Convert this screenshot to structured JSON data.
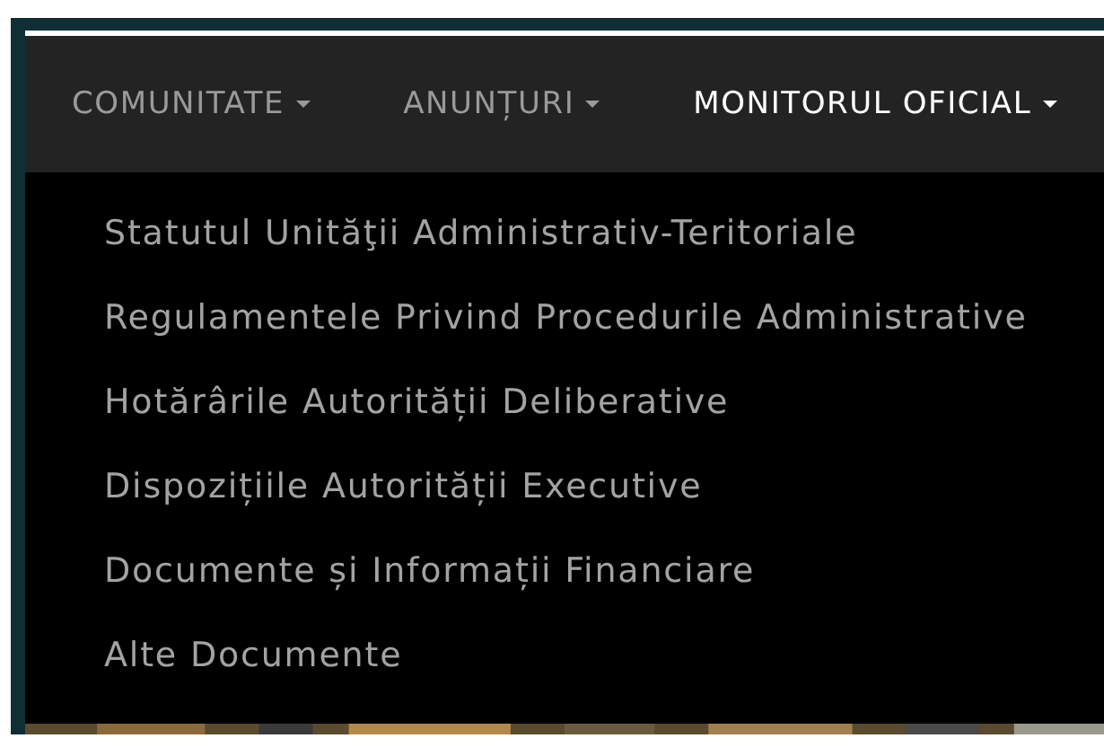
{
  "nav": [
    {
      "label": "COMUNITATE",
      "dropdown": true,
      "selected": false
    },
    {
      "label": "ANUNȚURI",
      "dropdown": true,
      "selected": false
    },
    {
      "label": "MONITORUL OFICIAL",
      "dropdown": true,
      "selected": true
    }
  ],
  "dropdown_menu": [
    {
      "label": "Statutul Unităţii Administrativ-Teritoriale"
    },
    {
      "label": "Regulamentele Privind Procedurile Administrative"
    },
    {
      "label": "Hotărârile Autorității Deliberative"
    },
    {
      "label": "Dispozițiile Autorității Executive"
    },
    {
      "label": "Documente și Informații Financiare"
    },
    {
      "label": "Alte Documente"
    }
  ]
}
